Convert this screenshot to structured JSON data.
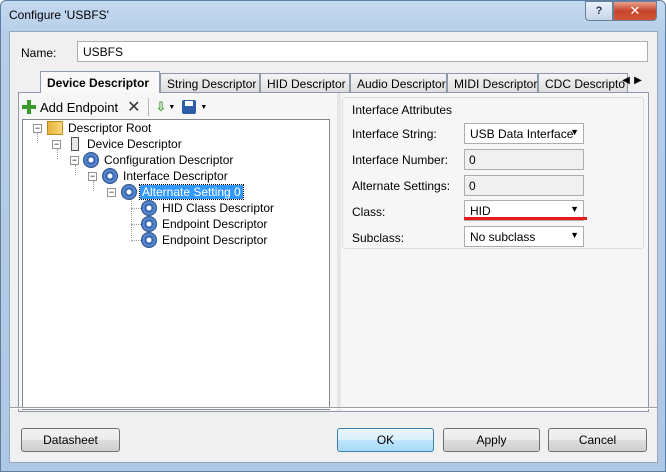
{
  "window": {
    "title": "Configure 'USBFS'",
    "help_label": "?",
    "close_label": "✕"
  },
  "name": {
    "label": "Name:",
    "value": "USBFS"
  },
  "tabs": [
    {
      "label": "Device Descriptor",
      "active": true
    },
    {
      "label": "String Descriptor"
    },
    {
      "label": "HID Descriptor"
    },
    {
      "label": "Audio Descriptor"
    },
    {
      "label": "MIDI Descriptor"
    },
    {
      "label": "CDC Descripto"
    }
  ],
  "toolbar": {
    "add_endpoint": "Add Endpoint"
  },
  "tree": {
    "root": "Descriptor Root",
    "device": "Device Descriptor",
    "config": "Configuration Descriptor",
    "interface": "Interface Descriptor",
    "alternate": "Alternate Setting 0",
    "hid": "HID Class Descriptor",
    "endpoint1": "Endpoint Descriptor",
    "endpoint2": "Endpoint Descriptor"
  },
  "attributes": {
    "group_title": "Interface Attributes",
    "interface_string_label": "Interface String:",
    "interface_string_value": "USB Data Interface",
    "interface_number_label": "Interface Number:",
    "interface_number_value": "0",
    "alternate_settings_label": "Alternate Settings:",
    "alternate_settings_value": "0",
    "class_label": "Class:",
    "class_value": "HID",
    "subclass_label": "Subclass:",
    "subclass_value": "No subclass"
  },
  "buttons": {
    "datasheet": "Datasheet",
    "ok": "OK",
    "apply": "Apply",
    "cancel": "Cancel"
  },
  "colors": {
    "highlight": "#e41b1b",
    "selection": "#3399ff"
  }
}
